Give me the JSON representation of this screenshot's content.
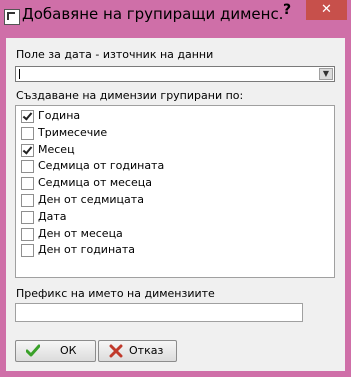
{
  "window": {
    "title": "Добавяне на групиращи дименс...",
    "help_label": "?",
    "close_label": "✕"
  },
  "source_field": {
    "label": "Поле за дата - източник на данни",
    "value": ""
  },
  "create_by": {
    "label": "Създаване на димензии групирани по:",
    "items": [
      {
        "label": "Година",
        "checked": true
      },
      {
        "label": "Тримесечие",
        "checked": false
      },
      {
        "label": "Месец",
        "checked": true
      },
      {
        "label": "Седмица от годината",
        "checked": false
      },
      {
        "label": "Седмица от месеца",
        "checked": false
      },
      {
        "label": "Ден от седмицата",
        "checked": false
      },
      {
        "label": "Дата",
        "checked": false
      },
      {
        "label": "Ден от месеца",
        "checked": false
      },
      {
        "label": "Ден от годината",
        "checked": false
      }
    ]
  },
  "prefix": {
    "label": "Префикс на името на димензиите",
    "value": ""
  },
  "buttons": {
    "ok_label": "ОК",
    "cancel_label": "Отказ"
  },
  "colors": {
    "window_frame": "#cf6fa8",
    "close_button": "#c7504b",
    "ok_icon": "#3aa12a",
    "cancel_icon": "#c0392b"
  }
}
